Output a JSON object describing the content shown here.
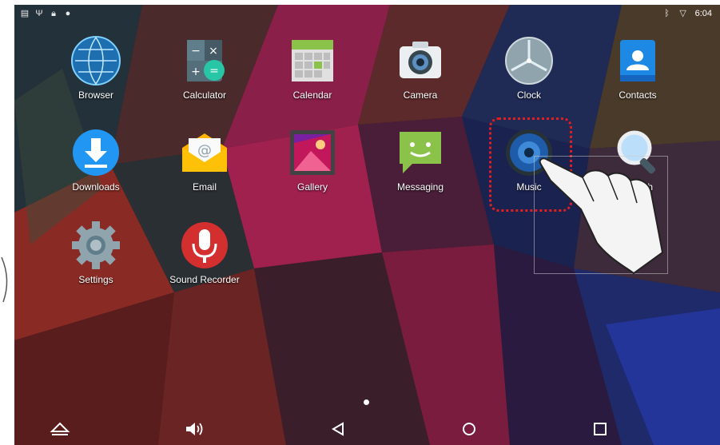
{
  "status_bar": {
    "left_icons": [
      "sim-icon",
      "usb-icon",
      "lock-icon",
      "android-debug-icon"
    ],
    "right_icons": [
      "bluetooth-icon",
      "wifi-icon"
    ],
    "time": "6:04"
  },
  "apps": [
    {
      "label": "Browser",
      "icon": "globe-icon"
    },
    {
      "label": "Calculator",
      "icon": "calculator-icon"
    },
    {
      "label": "Calendar",
      "icon": "calendar-icon"
    },
    {
      "label": "Camera",
      "icon": "camera-icon"
    },
    {
      "label": "Clock",
      "icon": "clock-icon"
    },
    {
      "label": "Contacts",
      "icon": "contacts-icon"
    },
    {
      "label": "Downloads",
      "icon": "download-icon"
    },
    {
      "label": "Email",
      "icon": "email-icon"
    },
    {
      "label": "Gallery",
      "icon": "gallery-icon"
    },
    {
      "label": "Messaging",
      "icon": "messaging-icon"
    },
    {
      "label": "Music",
      "icon": "music-speaker-icon"
    },
    {
      "label": "Search",
      "icon": "magnifier-icon"
    },
    {
      "label": "Settings",
      "icon": "gear-icon"
    },
    {
      "label": "Sound Recorder",
      "icon": "microphone-icon"
    }
  ],
  "page_indicator": {
    "current": 1,
    "total": 1
  },
  "nav_bar": [
    "home-up-icon",
    "volume-icon",
    "back-icon",
    "home-icon",
    "recents-icon"
  ],
  "annotation": {
    "highlighted_app": "Music",
    "gesture": "tap"
  },
  "colors": {
    "highlight": "#e02020",
    "label": "#ffffff"
  }
}
